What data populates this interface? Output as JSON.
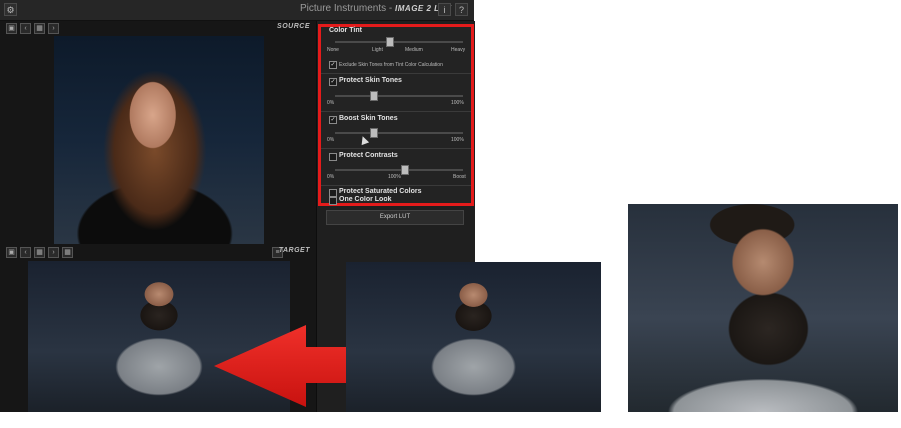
{
  "app": {
    "title_prefix": "Picture Instruments - ",
    "title_strong": "IMAGE 2 LUT",
    "settings_icon": "gear-icon",
    "info_label": "i",
    "help_label": "?"
  },
  "source": {
    "label": "SOURCE"
  },
  "target": {
    "label": "TARGET"
  },
  "toolbar_icons": [
    "image-icon",
    "chevron-left-icon",
    "folder-icon",
    "chevron-right-icon",
    "grid-icon"
  ],
  "panel": {
    "color_tint": {
      "title": "Color Tint",
      "labels": [
        "None",
        "Light",
        "Medium",
        "Heavy"
      ],
      "value": 0.42
    },
    "exclude_skin": {
      "checked": true,
      "label": "Exclude Skin Tones from Tint Color Calculation"
    },
    "protect_skin": {
      "checked": true,
      "title": "Protect Skin Tones",
      "min": "0%",
      "max": "100%",
      "value": 0.3
    },
    "boost_skin": {
      "checked": true,
      "title": "Boost Skin Tones",
      "min": "0%",
      "max": "100%",
      "value": 0.3
    },
    "protect_contrasts": {
      "checked": false,
      "title": "Protect Contrasts",
      "min": "0%",
      "mid": "100%",
      "max": "Boost",
      "value": 0.54
    },
    "protect_saturated": {
      "checked": false,
      "title": "Protect Saturated Colors"
    },
    "one_color": {
      "checked": false,
      "title": "One Color Look"
    }
  },
  "export": {
    "label": "Export LUT"
  },
  "colors": {
    "highlight": "#e41b1b",
    "arrow": "#e41b1b"
  }
}
